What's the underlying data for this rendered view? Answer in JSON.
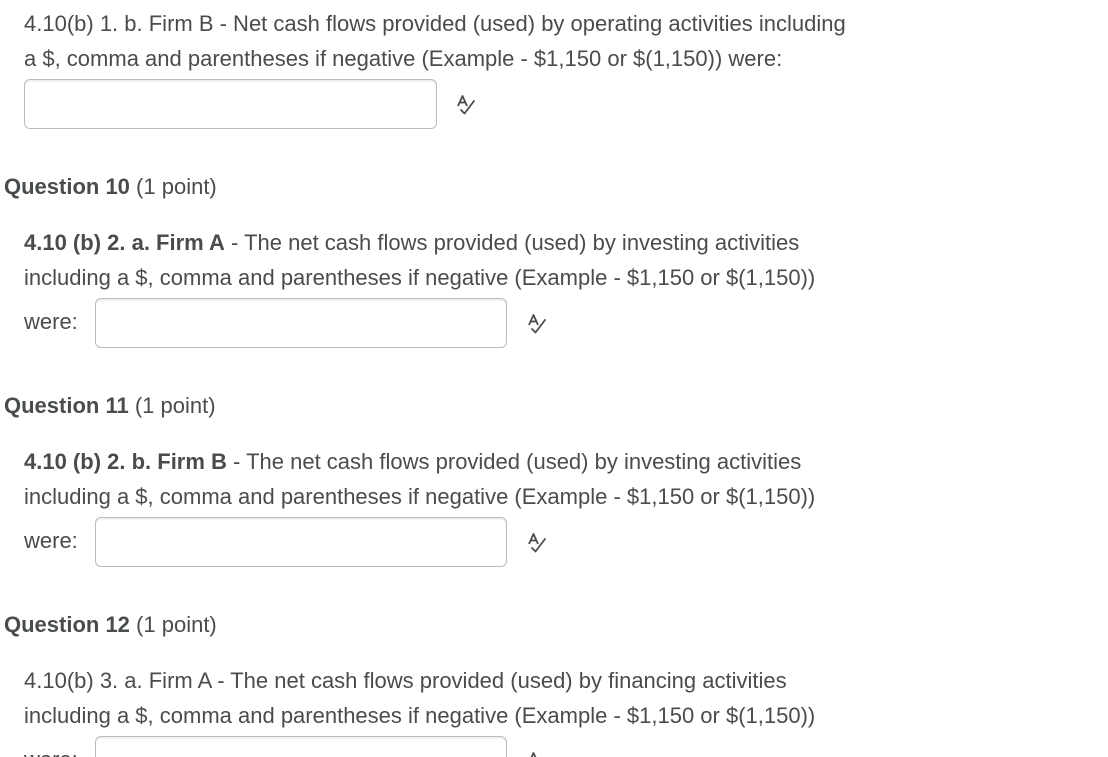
{
  "q9": {
    "line1": "4.10(b) 1. b. Firm B - Net cash flows provided (used) by operating activities including",
    "line2": "a $, comma and parentheses if negative (Example - $1,150 or $(1,150)) were:",
    "answer_value": ""
  },
  "q10": {
    "title": "Question 10",
    "points": "(1 point)",
    "bold_prefix": "4.10 (b) 2. a. Firm A",
    "line1_rest": " - The net cash flows provided (used) by investing activities",
    "line2": "including a $, comma and parentheses if negative (Example - $1,150 or $(1,150))",
    "were": "were:",
    "answer_value": ""
  },
  "q11": {
    "title": "Question 11",
    "points": "(1 point)",
    "bold_prefix": "4.10 (b) 2. b.  Firm B",
    "line1_rest": " - The net cash flows provided (used) by investing activities",
    "line2": "including a $, comma and parentheses if negative (Example - $1,150 or $(1,150))",
    "were": "were:",
    "answer_value": ""
  },
  "q12": {
    "title": "Question 12",
    "points": "(1 point)",
    "line1": "4.10(b) 3. a. Firm A - The net cash flows provided (used) by financing activities",
    "line2": "including a $, comma and parentheses if negative (Example - $1,150 or $(1,150))",
    "were": "were:",
    "answer_value": ""
  },
  "icons": {
    "spellcheck": "spellcheck-icon"
  }
}
